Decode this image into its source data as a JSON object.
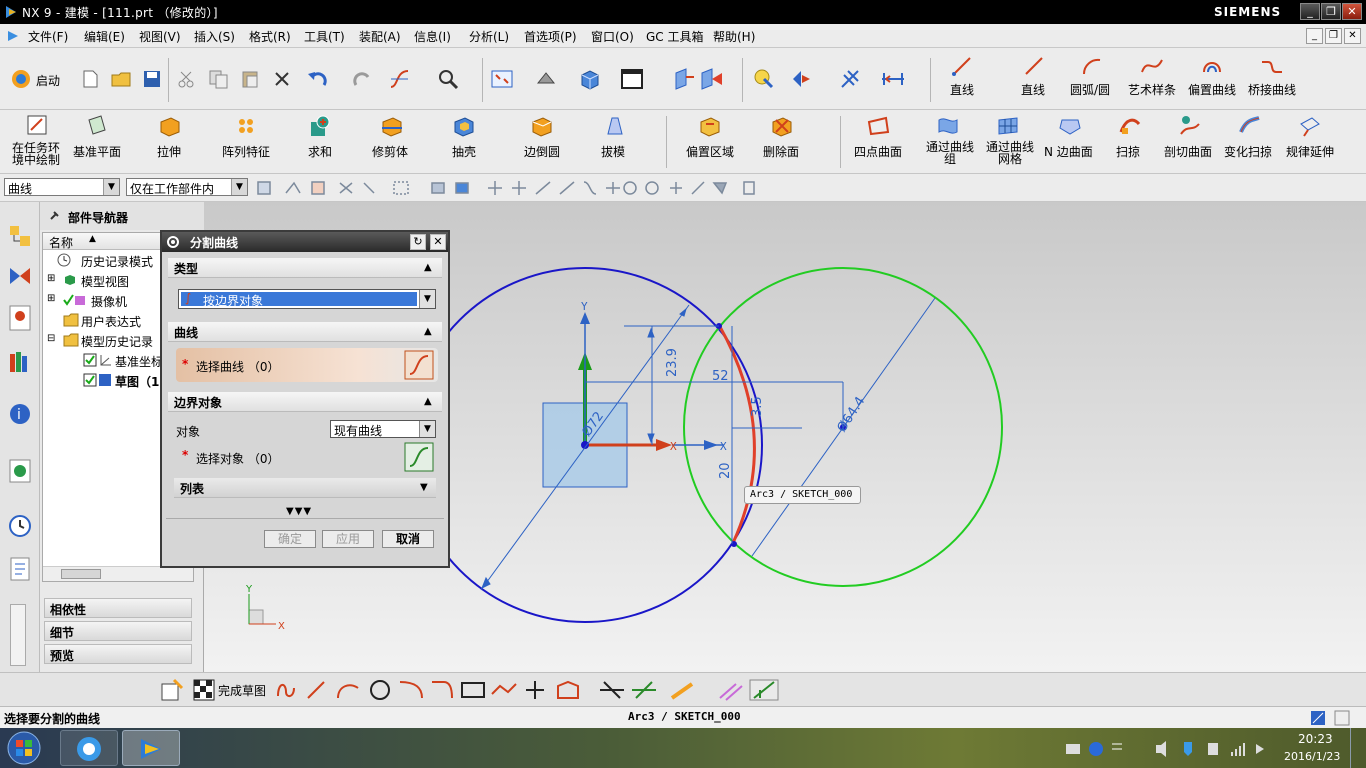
{
  "window": {
    "title": "NX 9 - 建模 - [111.prt （修改的）]",
    "brand": "SIEMENS",
    "controls": [
      "_",
      "❐",
      "✕"
    ]
  },
  "menubar": {
    "items": [
      "文件(F)",
      "编辑(E)",
      "视图(V)",
      "插入(S)",
      "格式(R)",
      "工具(T)",
      "装配(A)",
      "信息(I)",
      "分析(L)",
      "首选项(P)",
      "窗口(O)",
      "GC 工具箱",
      "帮助(H)"
    ]
  },
  "toolbar1": {
    "start": "启动",
    "curves": [
      "直线",
      "直线",
      "圆弧/圆",
      "艺术样条",
      "偏置曲线",
      "桥接曲线"
    ]
  },
  "toolbar2": {
    "items": [
      "在任务环境中绘制",
      "基准平面",
      "拉伸",
      "阵列特征",
      "求和",
      "修剪体",
      "抽壳",
      "边倒圆",
      "拔模",
      "偏置区域",
      "删除面",
      "四点曲面",
      "通过曲线组",
      "通过曲线网格",
      "N 边曲面",
      "扫掠",
      "剖切曲面",
      "变化扫掠",
      "规律延伸"
    ]
  },
  "selectionbar": {
    "filter": "曲线",
    "scope": "仅在工作部件内"
  },
  "navigator": {
    "title": "部件导航器",
    "column": "名称",
    "rows": [
      "历史记录模式",
      "模型视图",
      "摄像机",
      "用户表达式",
      "模型历史记录",
      "基准坐标",
      "草图（1"
    ],
    "sections": [
      "相依性",
      "细节",
      "预览"
    ]
  },
  "dialog": {
    "title": "分割曲线",
    "sections": {
      "type": "类型",
      "curve": "曲线",
      "boundary": "边界对象",
      "list": "列表"
    },
    "type_value": "按边界对象",
    "select_curve": "选择曲线 （0）",
    "object_label": "对象",
    "object_value": "现有曲线",
    "select_object": "选择对象 （0）",
    "ok": "确定",
    "apply": "应用",
    "cancel": "取消"
  },
  "sketch": {
    "dims": [
      "52",
      "23.9",
      "3.5",
      "20",
      "Ø64.4",
      "Ø72"
    ],
    "tooltip": "Arc3 / SKETCH_000",
    "x_axis": "X",
    "y_axis": "Y"
  },
  "bottombar": {
    "finish": "完成草图"
  },
  "statusbar": {
    "prompt": "选择要分割的曲线",
    "info": "Arc3 / SKETCH_000"
  },
  "taskbar": {
    "time": "20:23",
    "date": "2016/1/23"
  },
  "colors": {
    "circle_left": "#1a16c8",
    "circle_right": "#22cc22",
    "split_arc": "#e0402a"
  }
}
